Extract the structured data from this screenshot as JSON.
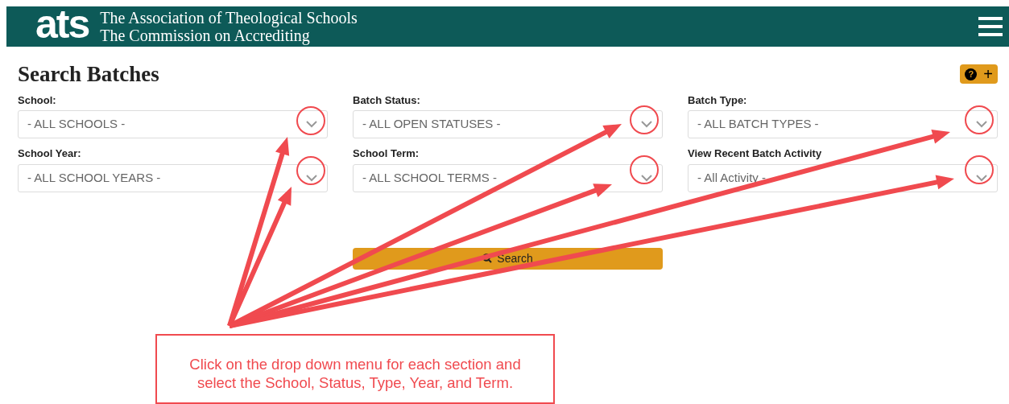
{
  "header": {
    "logo": "ats",
    "title_lines": [
      "The Association of Theological Schools",
      "The Commission on Accrediting"
    ]
  },
  "page_title": "Search Batches",
  "toolbar": {
    "help": "?",
    "add": "+"
  },
  "filters": [
    {
      "label": "School:",
      "value": "- ALL SCHOOLS -"
    },
    {
      "label": "Batch Status:",
      "value": "- ALL OPEN STATUSES -"
    },
    {
      "label": "Batch Type:",
      "value": "- ALL BATCH TYPES -"
    },
    {
      "label": "School Year:",
      "value": "- ALL SCHOOL YEARS -"
    },
    {
      "label": "School Term:",
      "value": "- ALL SCHOOL TERMS -"
    },
    {
      "label": "View Recent Batch Activity",
      "value": "- All Activity -"
    }
  ],
  "search_button": "Search",
  "callout": "Click on the drop down menu for each section and select the School, Status, Type, Year, and Term."
}
